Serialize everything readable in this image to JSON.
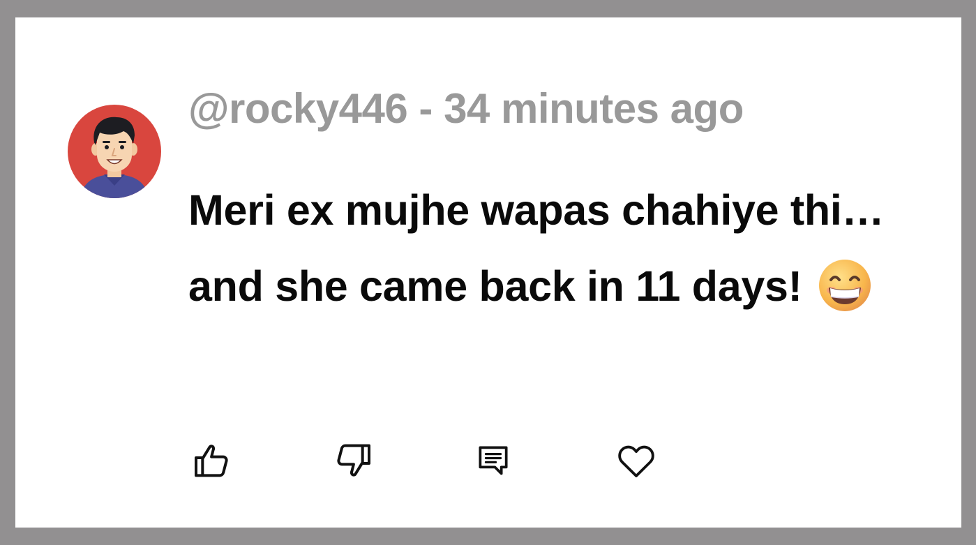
{
  "comment": {
    "username": "@rocky446",
    "separator": " - ",
    "timestamp": "34 minutes ago",
    "text": "Meri ex mujhe wapas chahiye thi… and she came back in 11 days!",
    "emoji": "beaming-face-with-smiling-eyes"
  },
  "avatar": {
    "icon": "cartoon-man-avatar",
    "background_color": "#d9463e"
  },
  "actions": [
    {
      "icon": "thumbs-up-icon"
    },
    {
      "icon": "thumbs-down-icon"
    },
    {
      "icon": "reply-icon"
    },
    {
      "icon": "heart-icon"
    }
  ],
  "colors": {
    "frame": "#929091",
    "card": "#ffffff",
    "meta_text": "#999999",
    "body_text": "#0a0a0a"
  }
}
